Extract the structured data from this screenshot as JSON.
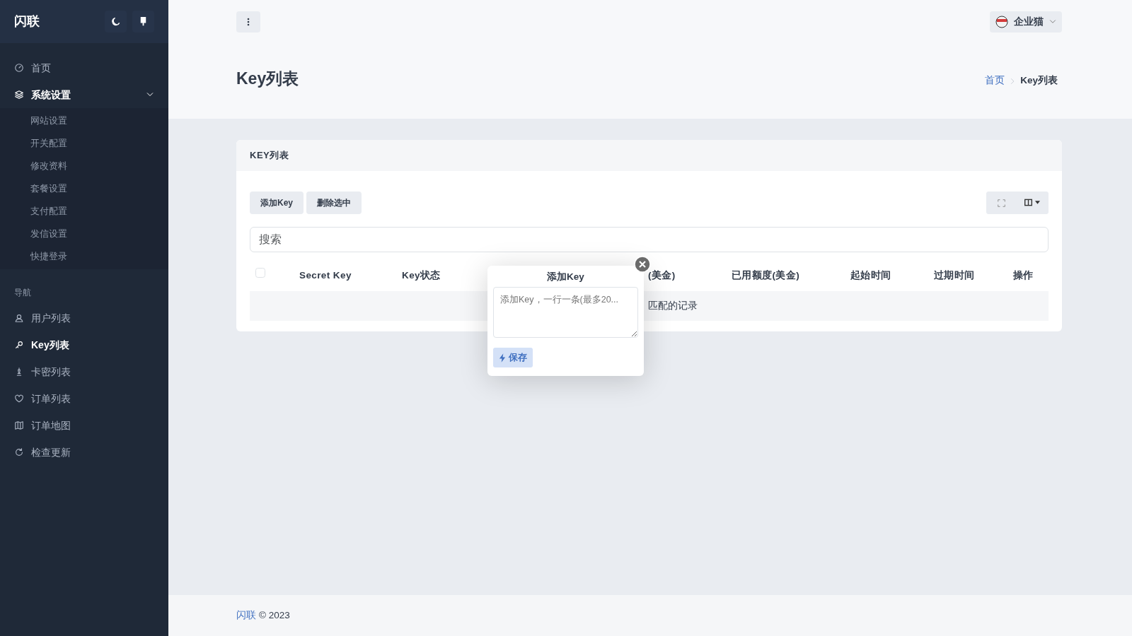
{
  "sidebar": {
    "brand": "闪联",
    "items": [
      {
        "label": "首页",
        "selected": false,
        "expanded": false
      },
      {
        "label": "系统设置",
        "selected": false,
        "expanded": true,
        "children": [
          {
            "label": "网站设置",
            "selected": false
          },
          {
            "label": "开关配置",
            "selected": false
          },
          {
            "label": "修改资料",
            "selected": false
          },
          {
            "label": "套餐设置",
            "selected": false
          },
          {
            "label": "支付配置",
            "selected": false
          },
          {
            "label": "发信设置",
            "selected": false
          },
          {
            "label": "快捷登录",
            "selected": false
          }
        ]
      }
    ],
    "section_label": "导航",
    "nav_items": [
      {
        "label": "用户列表",
        "selected": false
      },
      {
        "label": "Key列表",
        "selected": true
      },
      {
        "label": "卡密列表",
        "selected": false
      },
      {
        "label": "订单列表",
        "selected": false
      },
      {
        "label": "订单地图",
        "selected": false
      },
      {
        "label": "检查更新",
        "selected": false
      }
    ]
  },
  "topbar": {
    "user": "企业猫"
  },
  "page": {
    "title": "Key列表",
    "breadcrumb": [
      {
        "label": "首页",
        "link": true
      },
      {
        "label": "Key列表",
        "link": false
      }
    ]
  },
  "card": {
    "title": "KEY列表",
    "buttons": [
      "添加Key",
      "删除选中"
    ],
    "search": {
      "placeholder": "搜索"
    },
    "table": {
      "select_all": {
        "checked": false
      },
      "columns": [
        "Secret Key",
        "Key状态",
        "(美金)",
        "已用额度(美金)",
        "起始时间",
        "过期时间",
        "操作"
      ],
      "empty_text": "匹配的记录"
    }
  },
  "popover": {
    "title": "添加Key",
    "placeholder": "添加Key，一行一条(最多20...",
    "save": "保存"
  },
  "footer": {
    "brand": "闪联",
    "text": "© 2023"
  }
}
